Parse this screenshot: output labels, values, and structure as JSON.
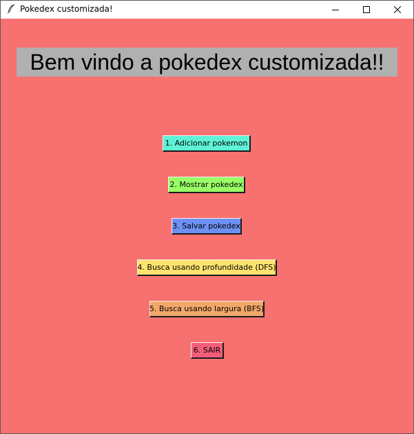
{
  "window": {
    "title": "Pokedex customizada!",
    "icon": "feather-icon",
    "controls": [
      "minimize-icon",
      "maximize-icon",
      "close-icon"
    ]
  },
  "main": {
    "background_color": "#f87171",
    "heading": "Bem vindo a pokedex customizada!!",
    "heading_background": "#b0b0b0",
    "menu": [
      {
        "label": "1. Adicionar pokemon",
        "color": "#5ff2d8"
      },
      {
        "label": "2. Mostrar pokedex",
        "color": "#99ff66"
      },
      {
        "label": "3. Salvar pokedex",
        "color": "#6d90f2"
      },
      {
        "label": "4. Busca usando profundidade (DFS)",
        "color": "#ffe36e"
      },
      {
        "label": "5. Busca usando largura (BFS)",
        "color": "#f2a86a"
      },
      {
        "label": "6. SAIR",
        "color": "#f25e7a"
      }
    ]
  }
}
